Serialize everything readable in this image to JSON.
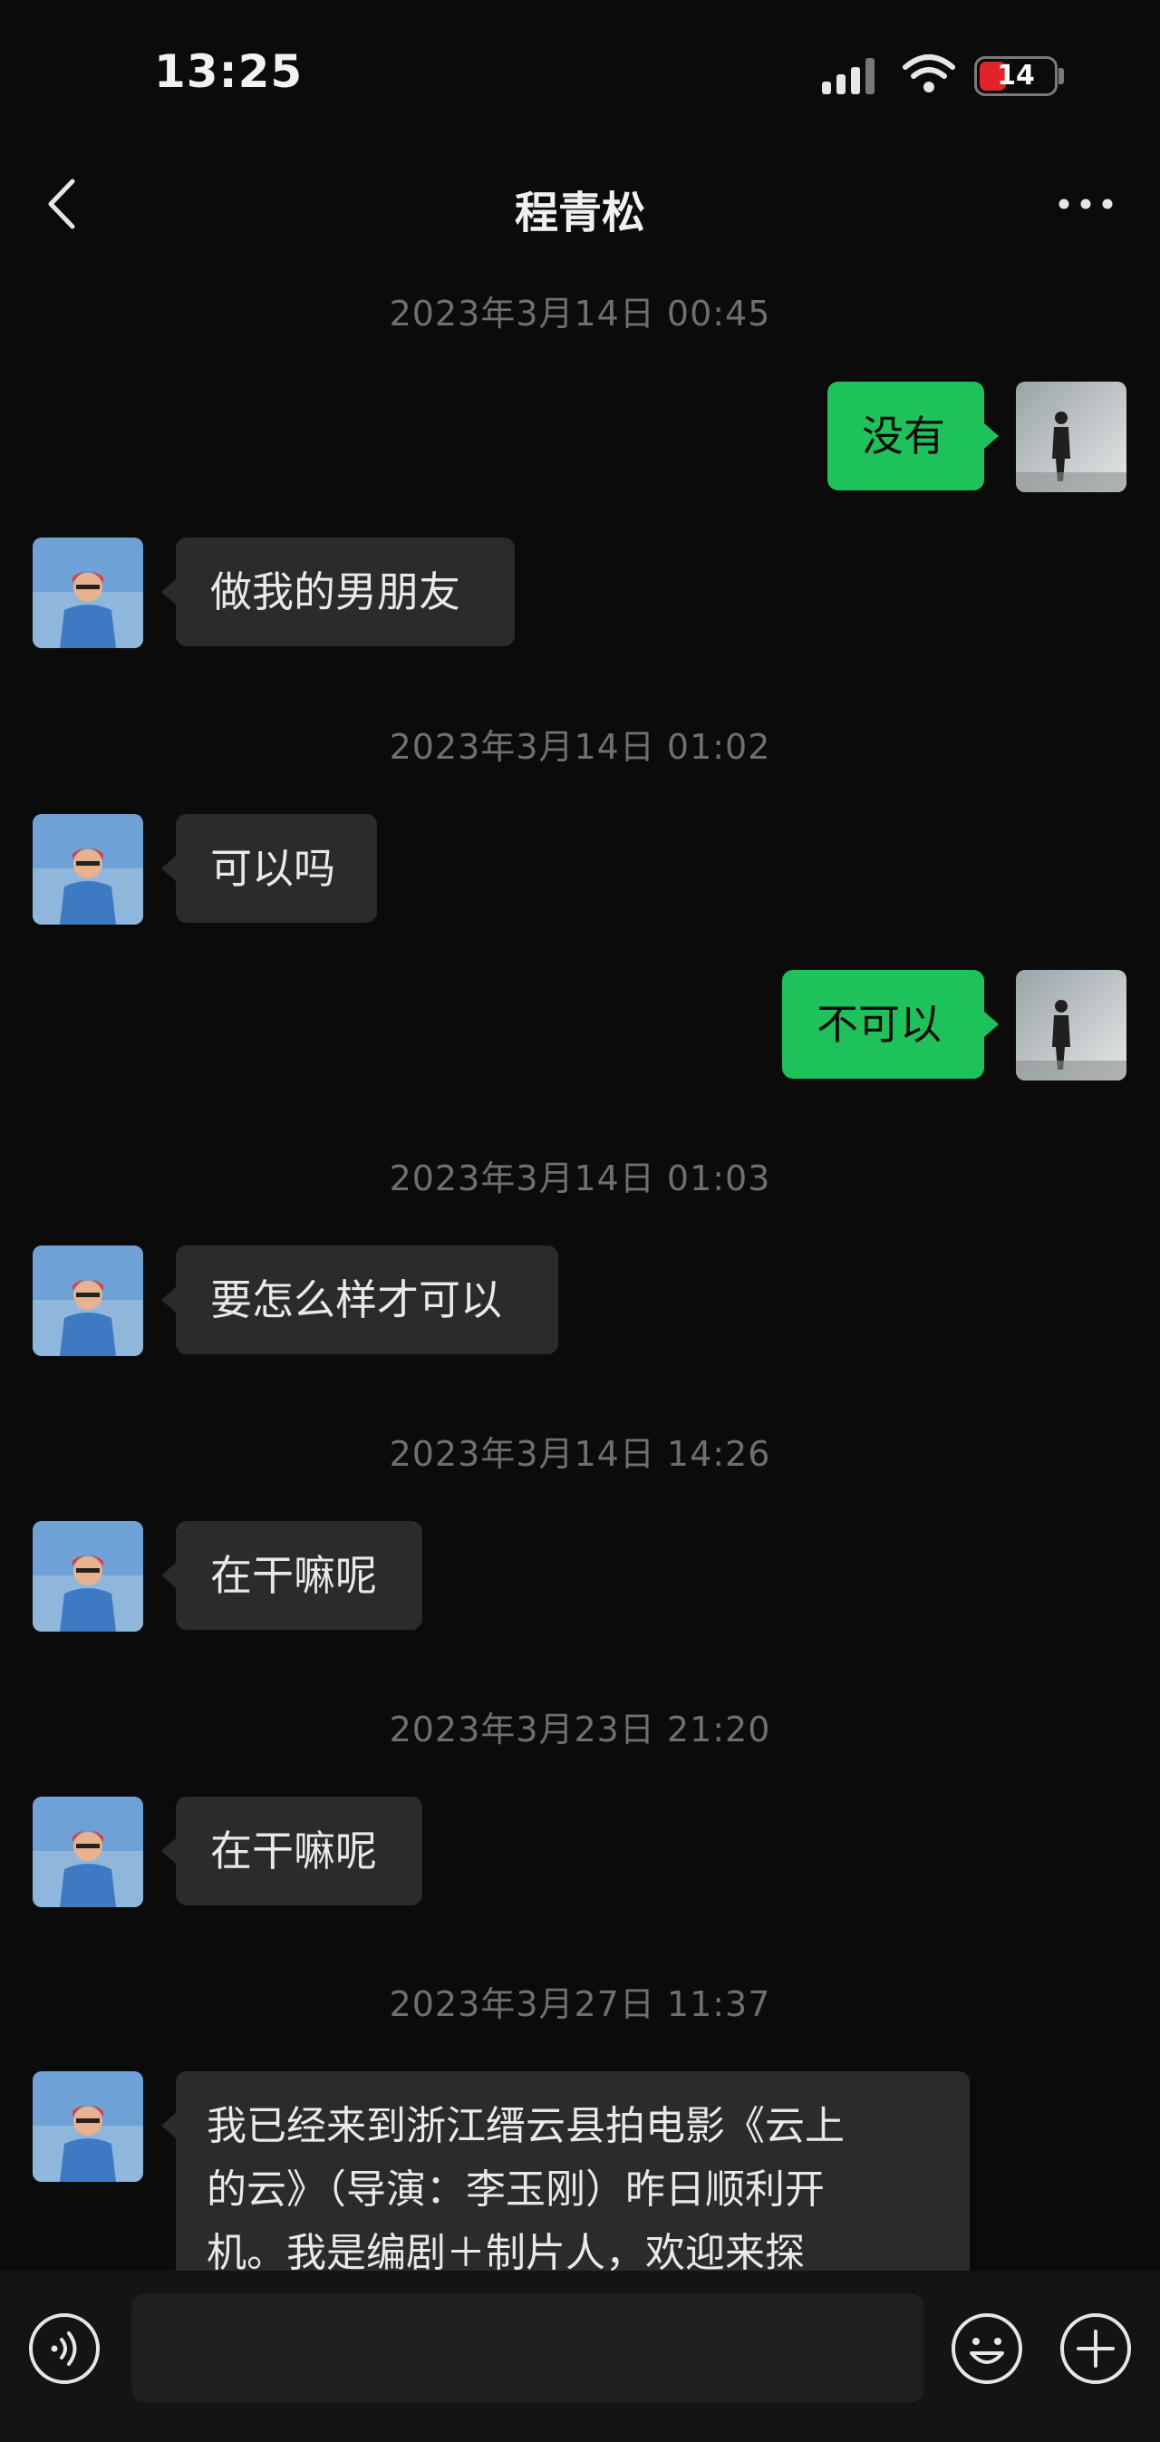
{
  "status_bar": {
    "time": "13:25",
    "battery": "14"
  },
  "chat": {
    "contact_name": "程青松"
  },
  "messages": [
    {
      "timestamp": "2023年3月14日 00:45"
    },
    {
      "text": "没有"
    },
    {
      "text": "做我的男朋友"
    },
    {
      "timestamp": "2023年3月14日 01:02"
    },
    {
      "text": "可以吗"
    },
    {
      "text": "不可以"
    },
    {
      "timestamp": "2023年3月14日 01:03"
    },
    {
      "text": "要怎么样才可以"
    },
    {
      "timestamp": "2023年3月14日 14:26"
    },
    {
      "text": "在干嘛呢"
    },
    {
      "timestamp": "2023年3月23日 21:20"
    },
    {
      "text": "在干嘛呢"
    },
    {
      "timestamp": "2023年3月27日 11:37"
    },
    {
      "text_lines": [
        "我已经来到浙江缙云县拍电影《云上",
        "的云》（导演：李玉刚）昨日顺利开",
        "机。我是编剧＋制片人，欢迎来探"
      ]
    }
  ],
  "input_bar": {
    "placeholder": ""
  },
  "colors": {
    "background": "#0b0b0c",
    "incoming_bubble": "#2b2b2d",
    "outgoing_bubble": "#1ec25a",
    "timestamp_text": "#6f6f6f"
  },
  "icons": [
    "back-arrow-icon",
    "more-dots-icon",
    "signal-icon",
    "wifi-icon",
    "battery-icon",
    "voice-icon",
    "emoji-icon",
    "plus-icon"
  ]
}
